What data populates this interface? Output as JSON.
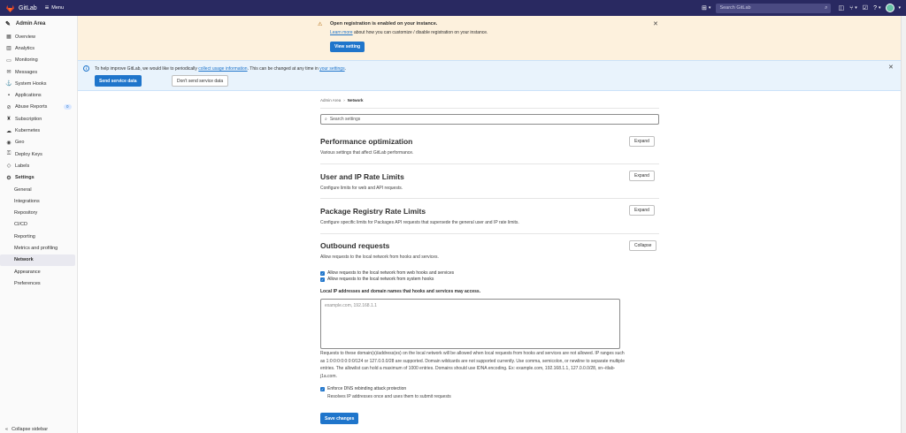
{
  "topbar": {
    "brand": "GitLab",
    "menu_label": "Menu",
    "search_placeholder": "Search GitLab",
    "search_icon": "search-icon",
    "icons": [
      "plus-icon",
      "issues-icon",
      "merge-request-icon",
      "todo-icon",
      "help-icon",
      "avatar"
    ]
  },
  "sidebar": {
    "header": "Admin Area",
    "items": [
      {
        "label": "Overview",
        "icon": "overview-icon"
      },
      {
        "label": "Analytics",
        "icon": "analytics-icon"
      },
      {
        "label": "Monitoring",
        "icon": "monitoring-icon"
      },
      {
        "label": "Messages",
        "icon": "messages-icon"
      },
      {
        "label": "System Hooks",
        "icon": "hook-icon"
      },
      {
        "label": "Applications",
        "icon": "applications-icon"
      },
      {
        "label": "Abuse Reports",
        "icon": "abuse-icon",
        "badge": "0"
      },
      {
        "label": "Subscription",
        "icon": "subscription-icon"
      },
      {
        "label": "Kubernetes",
        "icon": "kubernetes-icon"
      },
      {
        "label": "Geo",
        "icon": "geo-icon"
      },
      {
        "label": "Deploy Keys",
        "icon": "key-icon"
      },
      {
        "label": "Labels",
        "icon": "label-icon"
      },
      {
        "label": "Settings",
        "icon": "settings-icon"
      }
    ],
    "settings_sub": [
      "General",
      "Integrations",
      "Repository",
      "CI/CD",
      "Reporting",
      "Metrics and profiling",
      "Network",
      "Appearance",
      "Preferences"
    ],
    "active_sub": "Network",
    "collapse_label": "Collapse sidebar"
  },
  "registration_banner": {
    "title": "Open registration is enabled on your instance.",
    "link_text": "Learn more",
    "desc_rest": " about how you can customize / disable registration on your instance.",
    "button": "View setting"
  },
  "usage_banner": {
    "text_before": "To help improve GitLab, we would like to periodically ",
    "link1": "collect usage information",
    "text_middle": ". This can be changed at any time in ",
    "link2": "your settings",
    "text_after": ".",
    "send_button": "Send service data",
    "dont_button": "Don't send service data"
  },
  "breadcrumb": {
    "root": "Admin Area",
    "sep": "›",
    "current": "Network"
  },
  "settings_search_placeholder": "Search settings",
  "sections": [
    {
      "title": "Performance optimization",
      "desc": "Various settings that affect GitLab performance.",
      "button": "Expand"
    },
    {
      "title": "User and IP Rate Limits",
      "desc": "Configure limits for web and API requests.",
      "button": "Expand"
    },
    {
      "title": "Package Registry Rate Limits",
      "desc": "Configure specific limits for Packages API requests that supersede the general user and IP rate limits.",
      "button": "Expand"
    },
    {
      "title": "Outbound requests",
      "desc": "Allow requests to the local network from hooks and services.",
      "button": "Collapse"
    }
  ],
  "outbound": {
    "checkbox1": "Allow requests to the local network from web hooks and services",
    "checkbox2": "Allow requests to the local network from system hooks",
    "field_label": "Local IP addresses and domain names that hooks and services may access.",
    "textarea_placeholder": "example.com, 192.168.1.1",
    "help_text": "Requests to these domain(s)/address(es) on the local network will be allowed when local requests from hooks and services are not allowed. IP ranges such as 1:0:0:0:0:0:0:0/124 or 127.0.0.0/28 are supported. Domain wildcards are not supported currently. Use comma, semicolon, or newline to separate multiple entries. The allowlist can hold a maximum of 1000 entries. Domains should use IDNA encoding. Ex: example.com, 192.168.1.1, 127.0.0.0/28, xn--itlab-j1a.com.",
    "dns_label": "Enforce DNS rebinding attack protection",
    "dns_help": "Resolves IP addresses once and uses them to submit requests",
    "save_button": "Save changes"
  },
  "colors": {
    "navbar": "#292961",
    "primary": "#1f75cb",
    "warning_bg": "#fdf1dd",
    "info_bg": "#e9f3fc"
  }
}
